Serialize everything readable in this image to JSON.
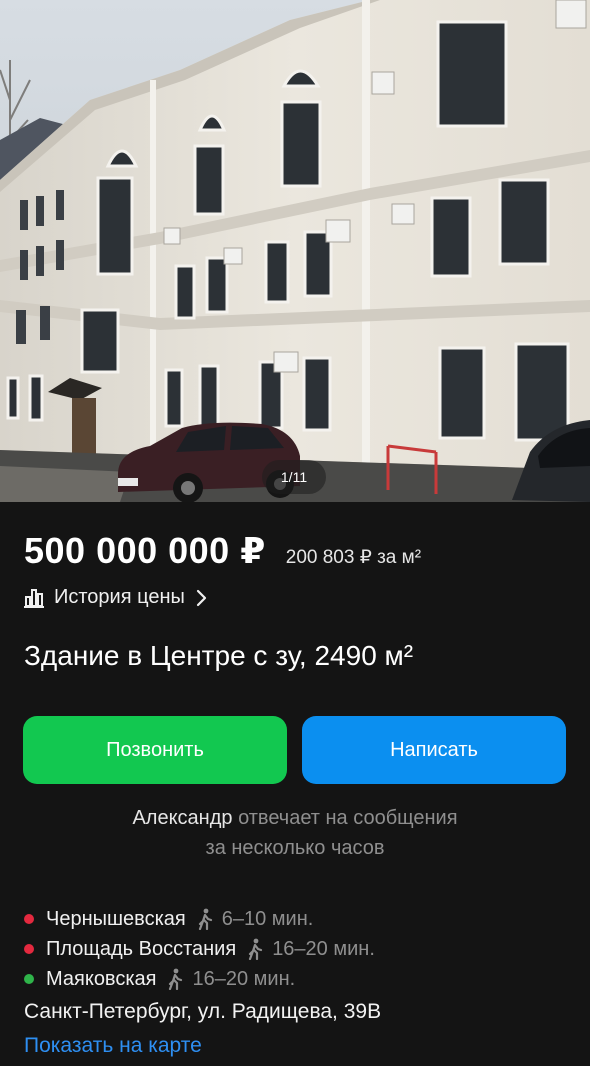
{
  "gallery": {
    "counter": "1/11"
  },
  "listing": {
    "price": "500 000 000 ₽",
    "price_per_m2": "200 803 ₽ за м²",
    "price_history_label": "История цены",
    "title": "Здание в Центре с зу, 2490 м²"
  },
  "actions": {
    "call_label": "Позвонить",
    "write_label": "Написать"
  },
  "seller": {
    "name": "Александр",
    "reply_text_part1": " отвечает на сообщения",
    "reply_text_part2": "за несколько часов"
  },
  "metro": [
    {
      "station": "Чернышевская",
      "time": "6–10 мин.",
      "color": "#e4293f"
    },
    {
      "station": "Площадь Восстания",
      "time": "16–20 мин.",
      "color": "#e4293f"
    },
    {
      "station": "Маяковская",
      "time": "16–20 мин.",
      "color": "#2fb44a"
    }
  ],
  "location": {
    "address": "Санкт-Петербург, ул. Радищева, 39В",
    "map_link": "Показать на карте"
  },
  "colors": {
    "background": "#141414",
    "call_button": "#12c850",
    "write_button": "#0b8ff0",
    "link": "#2e8ff2",
    "muted_text": "#8f8f8f"
  },
  "icons": {
    "price_history": "bar-chart-icon",
    "chevron": "chevron-right-icon",
    "walk": "walking-person-icon"
  }
}
